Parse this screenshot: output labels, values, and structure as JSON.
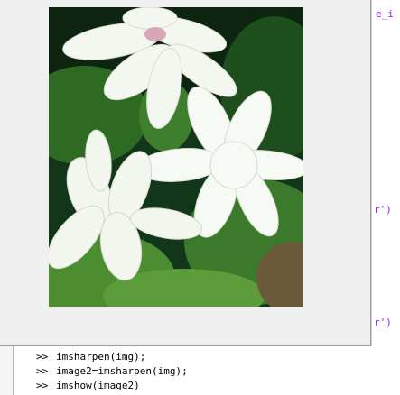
{
  "editor_fragments": [
    {
      "text": "e_i",
      "color": "#a020f0"
    },
    {
      "text": "r')",
      "color": "#a020f0"
    },
    {
      "text": "r')",
      "color": "#a020f0"
    }
  ],
  "figure": {
    "image": "jasmine-flowers-photo"
  },
  "command_window": {
    "prompt": ">>",
    "lines": [
      "imsharpen(img);",
      "image2=imsharpen(img);",
      "imshow(image2)"
    ]
  }
}
